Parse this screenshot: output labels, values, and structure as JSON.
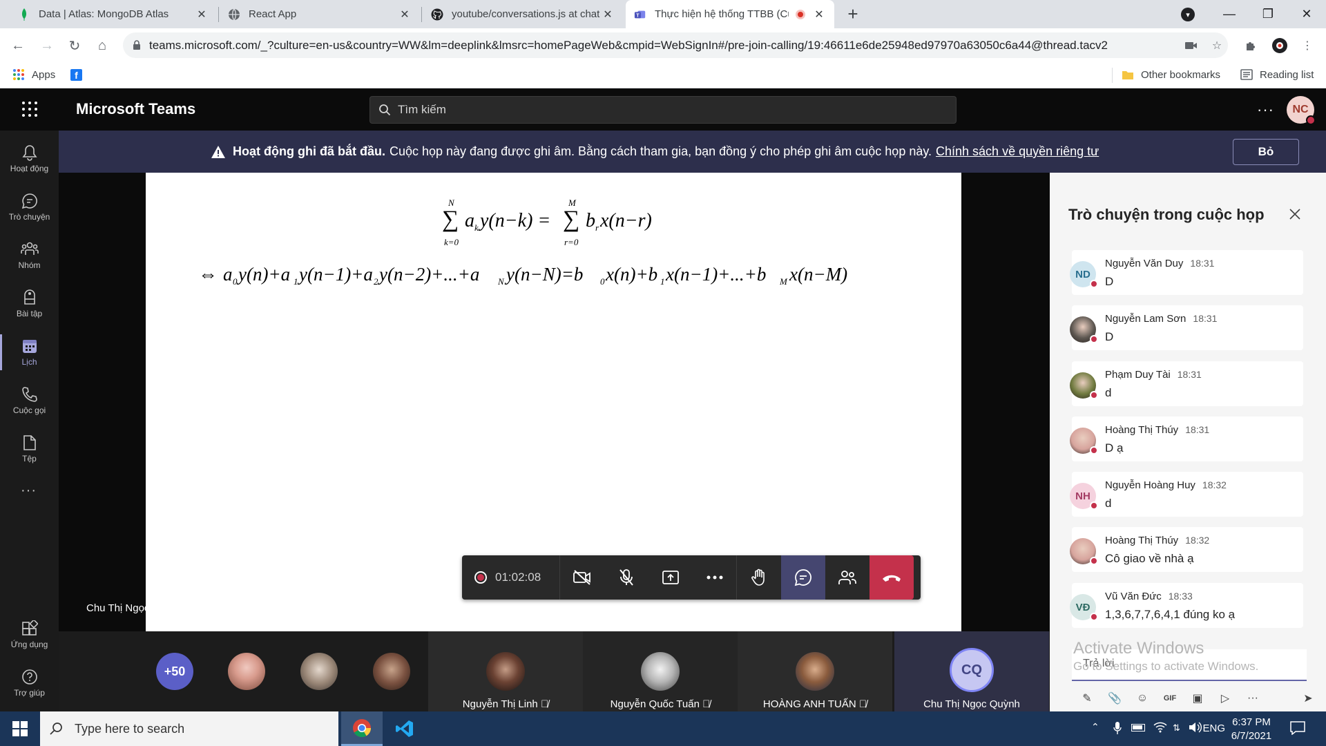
{
  "browser": {
    "tabs": [
      {
        "title": "Data | Atlas: MongoDB Atlas",
        "icon": "mongodb-leaf-icon"
      },
      {
        "title": "React App",
        "icon": "globe-icon"
      },
      {
        "title": "youtube/conversations.js at chat",
        "icon": "github-icon"
      },
      {
        "title": "Thực hiện hệ thống TTBB (Cu",
        "icon": "teams-icon",
        "recording": true
      }
    ],
    "url": "teams.microsoft.com/_?culture=en-us&country=WW&lm=deeplink&lmsrc=homePageWeb&cmpid=WebSignIn#/pre-join-calling/19:46611e6de25948ed97970a63050c6a44@thread.tacv2",
    "bookmarks": {
      "apps": "Apps",
      "other": "Other bookmarks",
      "reading_list": "Reading list"
    }
  },
  "teams": {
    "app_title": "Microsoft Teams",
    "search_placeholder": "Tìm kiếm",
    "user_initials": "NC",
    "rail": [
      {
        "label": "Hoạt động",
        "icon": "bell-icon"
      },
      {
        "label": "Trò chuyện",
        "icon": "chat-icon"
      },
      {
        "label": "Nhóm",
        "icon": "teams-group-icon"
      },
      {
        "label": "Bài tập",
        "icon": "assignments-icon"
      },
      {
        "label": "Lịch",
        "icon": "calendar-icon"
      },
      {
        "label": "Cuộc gọi",
        "icon": "phone-icon"
      },
      {
        "label": "Tệp",
        "icon": "file-icon"
      }
    ],
    "rail_bottom": [
      {
        "label": "Ứng dụng",
        "icon": "apps-icon"
      },
      {
        "label": "Trợ giúp",
        "icon": "help-icon"
      }
    ],
    "banner": {
      "bold": "Hoạt động ghi đã bắt đầu.",
      "text": "Cuộc họp này đang được ghi âm. Bằng cách tham gia, bạn đồng ý cho phép ghi âm cuộc họp này.",
      "link": "Chính sách về quyền riêng tư",
      "dismiss": "Bỏ"
    },
    "presenter": "Chu Thị Ngọc Quỳnh",
    "timer": "01:02:08",
    "participants": {
      "overflow": "+50",
      "tiles": [
        {
          "name": "Nguyễn Thị Linh"
        },
        {
          "name": "Nguyễn Quốc Tuấn"
        },
        {
          "name": "HOÀNG ANH TUẤN"
        },
        {
          "name": "Chu Thị Ngọc Quỳnh",
          "initials": "CQ"
        }
      ]
    }
  },
  "chat": {
    "title": "Trò chuyện trong cuộc họp",
    "messages": [
      {
        "initials": "ND",
        "name": "Nguyễn Văn Duy",
        "time": "18:31",
        "text": "D",
        "av_color": "#cfe5ef",
        "av_text": "#2a6f8f"
      },
      {
        "initials": "",
        "name": "Nguyễn Lam Sơn",
        "time": "18:31",
        "text": "D",
        "av_color": "#5c5650"
      },
      {
        "initials": "",
        "name": "Phạm Duy Tài",
        "time": "18:31",
        "text": "d",
        "av_color": "#6f7a3e"
      },
      {
        "initials": "",
        "name": "Hoàng Thị Thúy",
        "time": "18:31",
        "text": "D ạ",
        "av_color": "#d7a49d"
      },
      {
        "initials": "NH",
        "name": "Nguyễn Hoàng Huy",
        "time": "18:32",
        "text": "d",
        "av_color": "#f5d2de",
        "av_text": "#a33a62"
      },
      {
        "initials": "",
        "name": "Hoàng Thị Thúy",
        "time": "18:32",
        "text": "Cô giao về nhà ạ",
        "av_color": "#d7a49d"
      },
      {
        "initials": "VĐ",
        "name": "Vũ Văn Đức",
        "time": "18:33",
        "text": "1,3,6,7,7,6,4,1 đúng ko ạ",
        "av_color": "#d9e8e6",
        "av_text": "#2e6b63"
      }
    ],
    "reply_placeholder": "Trả lời",
    "watermark": {
      "line1": "Activate Windows",
      "line2": "Go to Settings to activate Windows."
    }
  },
  "taskbar": {
    "search_placeholder": "Type here to search",
    "lang": "ENG",
    "time": "6:37 PM",
    "date": "6/7/2021"
  },
  "colors": {
    "accent": "#6264a7",
    "leave": "#c4314b",
    "banner": "#2d2f4c"
  }
}
